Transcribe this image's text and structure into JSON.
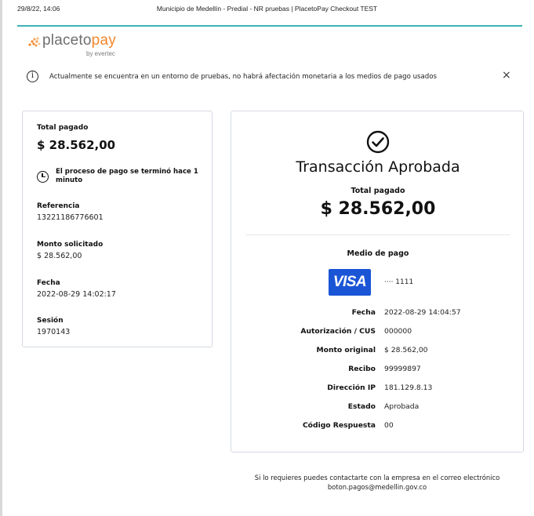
{
  "print_header": {
    "datetime": "29/8/22, 14:06",
    "title": "Municipio de Medellín - Predial - NR pruebas | PlacetoPay Checkout TEST"
  },
  "logo": {
    "brand_a": "placeto",
    "brand_b": "pay",
    "sub": "by evertec"
  },
  "alert": {
    "icon": "info-icon",
    "text": "Actualmente se encuentra en un entorno de pruebas, no habrá afectación monetaria a los medios de pago usados",
    "close": "×"
  },
  "summary": {
    "total_label": "Total pagado",
    "total_value": "$ 28.562,00",
    "process_text": "El proceso de pago se terminó hace 1 minuto",
    "reference_label": "Referencia",
    "reference_value": "13221186776601",
    "amount_label": "Monto solicitado",
    "amount_value": "$ 28.562,00",
    "date_label": "Fecha",
    "date_value": "2022-08-29 14:02:17",
    "session_label": "Sesión",
    "session_value": "1970143"
  },
  "transaction": {
    "title": "Transacción Aprobada",
    "total_label": "Total pagado",
    "total_value": "$ 28.562,00",
    "payment_method_label": "Medio de pago",
    "card_brand": "VISA",
    "card_number": "···· 1111",
    "details": [
      {
        "label": "Fecha",
        "value": "2022-08-29 14:04:57"
      },
      {
        "label": "Autorización / CUS",
        "value": "000000"
      },
      {
        "label": "Monto original",
        "value": "$ 28.562,00"
      },
      {
        "label": "Recibo",
        "value": "99999897"
      },
      {
        "label": "Dirección IP",
        "value": "181.129.8.13"
      },
      {
        "label": "Estado",
        "value": "Aprobada"
      },
      {
        "label": "Código Respuesta",
        "value": "00"
      }
    ]
  },
  "footer": {
    "line1": "Si lo requieres puedes contactarte con la empresa en el correo electrónico",
    "line2": "boton.pagos@medellin.gov.co"
  },
  "colors": {
    "accent_teal": "#3fb3b6",
    "logo_orange": "#f4872b",
    "visa_blue": "#1a55d6"
  }
}
